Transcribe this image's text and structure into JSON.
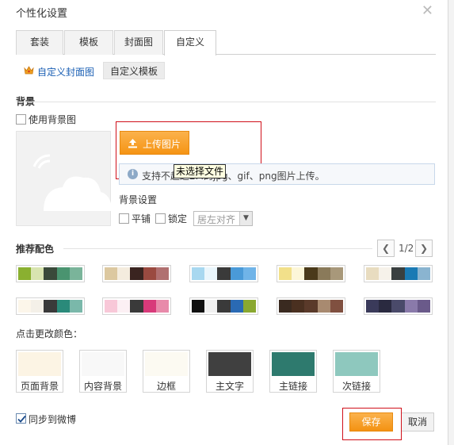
{
  "dialog": {
    "title": "个性化设置",
    "close_icon": "close-icon"
  },
  "tabs": [
    {
      "label": "套装",
      "active": false
    },
    {
      "label": "模板",
      "active": false
    },
    {
      "label": "封面图",
      "active": false
    },
    {
      "label": "自定义",
      "active": true
    }
  ],
  "subnav": {
    "cover_link": "自定义封面图",
    "template_button": "自定义模板"
  },
  "background": {
    "section_title": "背景",
    "use_bg_label": "使用背景图",
    "upload_label": "上传图片",
    "info_text": "支持不超过2M的jpg、gif、png图片上传。",
    "tooltip": "未选择文件",
    "settings_title": "背景设置",
    "tile_label": "平铺",
    "lock_label": "锁定",
    "align_value": "居左对齐"
  },
  "palette": {
    "section_title": "推荐配色",
    "pager": "1/2",
    "rows": [
      [
        [
          "#8ab030",
          "#d8e4b0",
          "#3a4a3a",
          "#4a9470",
          "#7ab49a"
        ],
        [
          "#dcc8a0",
          "#f4ecde",
          "#3a2420",
          "#9a4a40",
          "#b07070"
        ],
        [
          "#a8d8f0",
          "#eaf6fc",
          "#3a3a3a",
          "#4a9ad8",
          "#70b4e8"
        ],
        [
          "#f2e08a",
          "#fcf6d8",
          "#4a3a1a",
          "#8a7a5a",
          "#a8987a"
        ],
        [
          "#e8dcc0",
          "#f6f2ea",
          "#3a4040",
          "#1a7ab4",
          "#8ab4d0"
        ]
      ],
      [
        [
          "#fcf6ea",
          "#f4f0e8",
          "#3a3a3a",
          "#2a8a7a",
          "#7ab8aa"
        ],
        [
          "#f8c8d8",
          "#fcf0f4",
          "#3a3a3a",
          "#d83a7a",
          "#e88aaa"
        ],
        [
          "#101010",
          "#f0f0f0",
          "#3a3a3a",
          "#2a6ab4",
          "#8aa830"
        ],
        [
          "#3a2a20",
          "#4a3020",
          "#5a3a2a",
          "#a88a70",
          "#805040"
        ],
        [
          "#3a3a5a",
          "#2a2a40",
          "#4a4a6a",
          "#8a7aaa",
          "#6a5a8a"
        ]
      ]
    ]
  },
  "customize": {
    "hint": "点击更改颜色：",
    "items": [
      {
        "label": "页面背景",
        "color": "#fcf4e4"
      },
      {
        "label": "内容背景",
        "color": "#f8f8f8"
      },
      {
        "label": "边框",
        "color": "#fcfaf2"
      },
      {
        "label": "主文字",
        "color": "#404040"
      },
      {
        "label": "主链接",
        "color": "#2e7a6e"
      },
      {
        "label": "次链接",
        "color": "#8ec8be"
      }
    ]
  },
  "footer": {
    "sync_label": "同步到微博",
    "sync_checked": true,
    "save_label": "保存",
    "cancel_label": "取消"
  }
}
